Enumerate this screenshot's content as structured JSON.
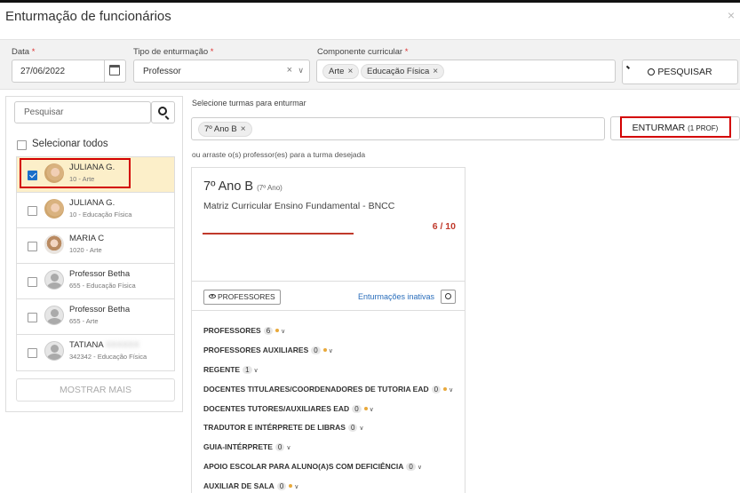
{
  "modal": {
    "title": "Enturmação de funcionários",
    "close_icon": "×"
  },
  "filters": {
    "data_label": "Data",
    "data_value": "27/06/2022",
    "tipo_label": "Tipo de enturmação",
    "tipo_value": "Professor",
    "componente_label": "Componente curricular",
    "componente_chips": [
      "Arte",
      "Educação Física"
    ],
    "required_mark": "*",
    "pesquisar_button": "PESQUISAR"
  },
  "left_panel": {
    "search_placeholder": "Pesquisar",
    "select_all_label": "Selecionar todos",
    "employees": [
      {
        "name": "JULIANA G.",
        "sub": "10 - Arte",
        "checked": true,
        "avatar": "photo"
      },
      {
        "name": "JULIANA G.",
        "sub": "10 - Educação Física",
        "checked": false,
        "avatar": "photo"
      },
      {
        "name": "MARIA C",
        "sub": "1020 - Arte",
        "checked": false,
        "avatar": "photo2"
      },
      {
        "name": "Professor Betha",
        "sub": "655 - Educação Física",
        "checked": false,
        "avatar": "default"
      },
      {
        "name": "Professor Betha",
        "sub": "655 - Arte",
        "checked": false,
        "avatar": "default"
      },
      {
        "name": "TATIANA",
        "sub": "342342 - Educação Física",
        "checked": false,
        "avatar": "default"
      }
    ],
    "show_more_button": "MOSTRAR MAIS"
  },
  "right_panel": {
    "select_turmas_label": "Selecione turmas para enturmar",
    "turma_chip": "7º Ano B",
    "enturmar_button": "ENTURMAR",
    "enturmar_count": "(1 PROF)",
    "drag_hint": "ou arraste o(s) professor(es) para a turma desejada",
    "card": {
      "turma": "7º Ano B",
      "turma_sub": "(7º Ano)",
      "matriz": "Matriz Curricular Ensino Fundamental - BNCC",
      "count": "6 / 10",
      "progress": 0.6,
      "professores_button": "PROFESSORES",
      "enturmacoes_inativas": "Enturmações inativas",
      "categories": [
        {
          "label": "PROFESSORES",
          "count": "6",
          "dot": true
        },
        {
          "label": "PROFESSORES AUXILIARES",
          "count": "0",
          "dot": true
        },
        {
          "label": "REGENTE",
          "count": "1",
          "dot": false
        },
        {
          "label": "DOCENTES TITULARES/COORDENADORES DE TUTORIA EAD",
          "count": "0",
          "dot": true
        },
        {
          "label": "DOCENTES TUTORES/AUXILIARES EAD",
          "count": "0",
          "dot": true
        },
        {
          "label": "TRADUTOR E INTÉRPRETE DE LIBRAS",
          "count": "0",
          "dot": false
        },
        {
          "label": "GUIA-INTÉRPRETE",
          "count": "0",
          "dot": false
        },
        {
          "label": "APOIO ESCOLAR PARA ALUNO(A)S COM DEFICIÊNCIA",
          "count": "0",
          "dot": false
        },
        {
          "label": "AUXILIAR DE SALA",
          "count": "0",
          "dot": true
        }
      ]
    }
  },
  "colors": {
    "selected_row": "#fcefc9",
    "highlight_frame": "#d30000",
    "accent_link": "#2a6ebb",
    "count_red": "#c0392b",
    "dot_yellow": "#e8a93b"
  }
}
